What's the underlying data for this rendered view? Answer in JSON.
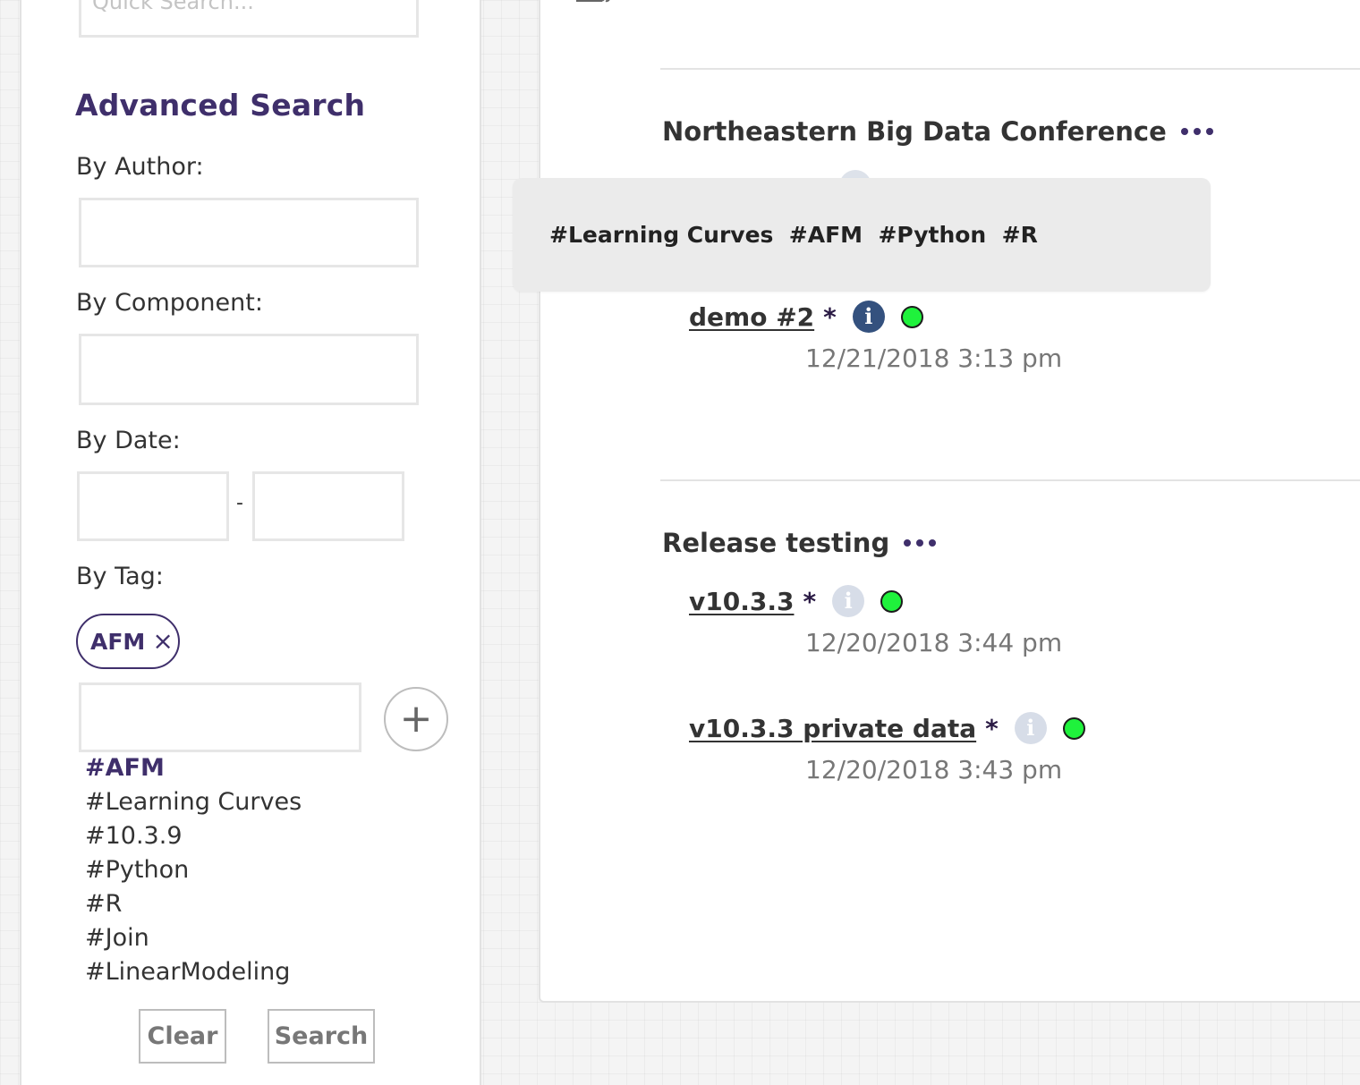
{
  "sidebar": {
    "quick_search_placeholder": "Quick Search...",
    "advanced_search_title": "Advanced Search",
    "by_author_label": "By Author:",
    "by_component_label": "By Component:",
    "by_date_label": "By Date:",
    "date_separator": "-",
    "by_tag_label": "By Tag:",
    "selected_tag": "AFM",
    "tag_suggestions": [
      "#AFM",
      "#Learning Curves",
      "#10.3.9",
      "#Python",
      "#R",
      "#Join",
      "#LinearModeling"
    ],
    "clear_label": "Clear",
    "search_label": "Search"
  },
  "tooltip": {
    "text": "#Learning Curves  #AFM  #Python  #R"
  },
  "groups": [
    {
      "title": "Northeastern Big Data Conference",
      "items": [
        {
          "title": "demo #2",
          "star": "*",
          "date": "12/21/2018 3:13 pm",
          "info_active": true
        }
      ]
    },
    {
      "title": "Release testing",
      "items": [
        {
          "title": "v10.3.3",
          "star": "*",
          "date": "12/20/2018 3:44 pm",
          "info_active": false
        },
        {
          "title": "v10.3.3 private data",
          "star": "*",
          "date": "12/20/2018 3:43 pm",
          "info_active": false
        }
      ]
    }
  ],
  "icons": {
    "info": "i",
    "add": "+",
    "remove_tag": "×"
  },
  "colors": {
    "brand_purple": "#3f2f6b",
    "info_active": "#34517e",
    "info_inactive": "#d7dde8",
    "status_green": "#1ff23c",
    "tooltip_bg": "#ebebeb"
  }
}
